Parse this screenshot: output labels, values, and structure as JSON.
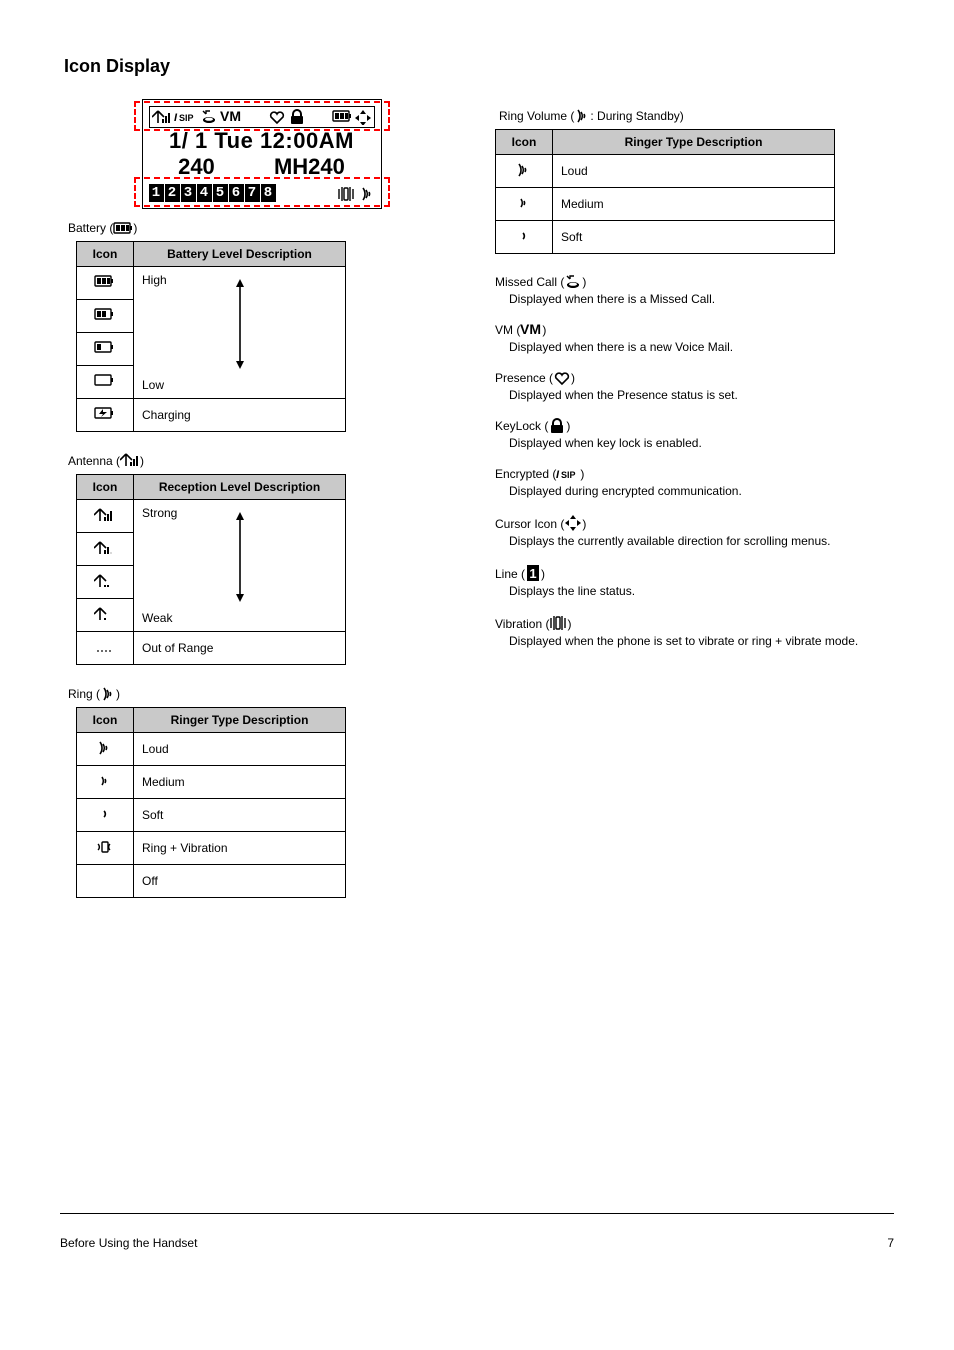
{
  "title": "Icon Display",
  "lcd": {
    "date_time": "1/ 1  Tue   12:00AM",
    "row2_left": "240",
    "row2_right": "MH240",
    "digits": [
      "1",
      "2",
      "3",
      "4",
      "5",
      "6",
      "7",
      "8"
    ]
  },
  "battery_section": {
    "heading_prefix": "Battery (",
    "heading_suffix": ")",
    "col1": "Icon",
    "col2": "Battery Level Description",
    "rows": [
      {
        "desc": "High"
      },
      {
        "desc": ""
      },
      {
        "desc": ""
      },
      {
        "desc": "Low"
      },
      {
        "desc": "Charging"
      }
    ]
  },
  "antenna_section": {
    "heading_prefix": "Antenna (",
    "heading_suffix": ")",
    "col1": "Icon",
    "col2": "Reception Level Description",
    "rows": [
      {
        "desc": "Strong"
      },
      {
        "desc": ""
      },
      {
        "desc": ""
      },
      {
        "desc": "Weak"
      },
      {
        "desc": "Out of Range"
      }
    ]
  },
  "ring_section_left": {
    "heading_prefix": "Ring (",
    "heading_suffix": ")",
    "col1": "Icon",
    "col2": "Ringer Type Description",
    "rows": [
      {
        "desc": "Loud"
      },
      {
        "desc": "Medium"
      },
      {
        "desc": "Soft"
      },
      {
        "desc": "Ring + Vibration"
      },
      {
        "desc": "Off"
      }
    ]
  },
  "ring_section_right": {
    "heading_prefix": "Ring Volume (",
    "heading_suffix": ": During Standby)",
    "col1": "Icon",
    "col2": "Ringer Type Description",
    "rows": [
      {
        "desc": "Loud"
      },
      {
        "desc": "Medium"
      },
      {
        "desc": "Soft"
      }
    ]
  },
  "defs": {
    "missed": {
      "lead_prefix": "Missed Call (",
      "lead_suffix": ")",
      "sub": "Displayed when there is a Missed Call."
    },
    "vm": {
      "lead_prefix": "VM (",
      "lead_mid": "VM",
      "lead_suffix": ")",
      "sub": "Displayed when there is a new Voice Mail."
    },
    "presence": {
      "lead_prefix": "Presence (",
      "lead_suffix": ")",
      "sub": "Displayed when the Presence status is set."
    },
    "keylock": {
      "lead_prefix": "KeyLock (",
      "lead_suffix": ")",
      "sub": "Displayed when key lock is enabled."
    },
    "encrypt": {
      "lead_prefix": "Encrypted (",
      "lead_suffix": ")",
      "sub": "Displayed during encrypted communication."
    },
    "cursor": {
      "lead_prefix": "Cursor Icon (",
      "lead_suffix": ")",
      "sub": "Displays the currently available direction for scrolling menus."
    },
    "line": {
      "lead_prefix": "Line (",
      "lead_suffix": ")",
      "sub": "Displays the line status."
    },
    "vib": {
      "lead_prefix": "Vibration (",
      "lead_suffix": ")",
      "sub": "Displayed when the phone is set to vibrate or ring + vibrate mode."
    }
  },
  "footer_left": "Before Using the Handset",
  "footer_right": "7"
}
